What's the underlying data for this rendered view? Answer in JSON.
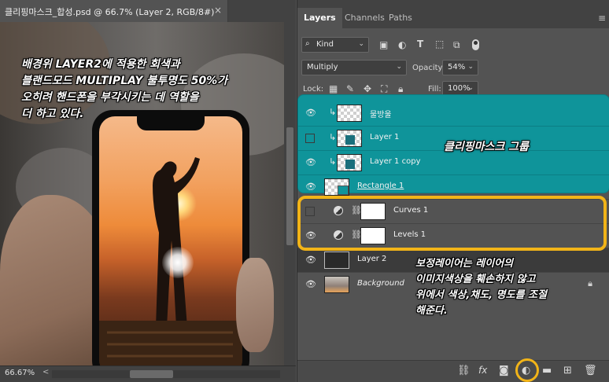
{
  "document": {
    "tab_title": "클리핑마스크_합성.psd @ 66.7% (Layer 2, RGB/8#)",
    "tab_close": "×",
    "annotation_lines": [
      "배경위 LAYER2에 적용한 회색과",
      "블랜드모드 MULTIPLAY  불투명도 50%가",
      "오히려 핸드폰을 부각시키는 데 역할을",
      "더 하고 있다."
    ],
    "status_zoom": "66.67%"
  },
  "panel": {
    "tabs": [
      {
        "label": "Layers",
        "active": true
      },
      {
        "label": "Channels",
        "active": false
      },
      {
        "label": "Paths",
        "active": false
      }
    ],
    "filter": {
      "kind_label": "Kind",
      "search_icon": "search-icon"
    },
    "blend": {
      "mode": "Multiply",
      "opacity_label": "Opacity:",
      "opacity_value": "54%"
    },
    "lock": {
      "label": "Lock:",
      "fill_label": "Fill:",
      "fill_value": "100%"
    },
    "layers": [
      {
        "name": "물방울",
        "visible": true,
        "clipped": true,
        "thumb": "checker",
        "italic": false
      },
      {
        "name": "Layer 1",
        "visible": false,
        "clipped": true,
        "thumb": "photo",
        "italic": false
      },
      {
        "name": "Layer 1 copy",
        "visible": true,
        "clipped": true,
        "thumb": "photo",
        "italic": false
      },
      {
        "name": "Rectangle 1",
        "visible": true,
        "clipped": false,
        "thumb": "shape",
        "italic": false
      },
      {
        "name": "Curves 1",
        "visible": false,
        "clipped": false,
        "thumb": "adjustment",
        "italic": false
      },
      {
        "name": "Levels 1",
        "visible": true,
        "clipped": false,
        "thumb": "adjustment",
        "italic": false
      },
      {
        "name": "Layer 2",
        "visible": true,
        "clipped": false,
        "thumb": "dark",
        "italic": false
      },
      {
        "name": "Background",
        "visible": true,
        "clipped": false,
        "thumb": "photo-bg",
        "italic": true,
        "locked": true
      }
    ],
    "group_annotation": "클리핑마스크 그룹",
    "adjustment_annotation_lines": [
      "보정레이어는 레이어의",
      "이미지색상을 훼손하지 않고",
      "위에서 색상,채도, 명도를 조절",
      "해준다."
    ],
    "footer_icons": [
      "link-icon",
      "fx-icon",
      "mask-icon",
      "adjustment-icon",
      "folder-icon",
      "new-layer-icon",
      "trash-icon"
    ]
  },
  "colors": {
    "panel_bg": "#535353",
    "group_highlight": "#0f949a",
    "callout_yellow": "#f2b418"
  }
}
